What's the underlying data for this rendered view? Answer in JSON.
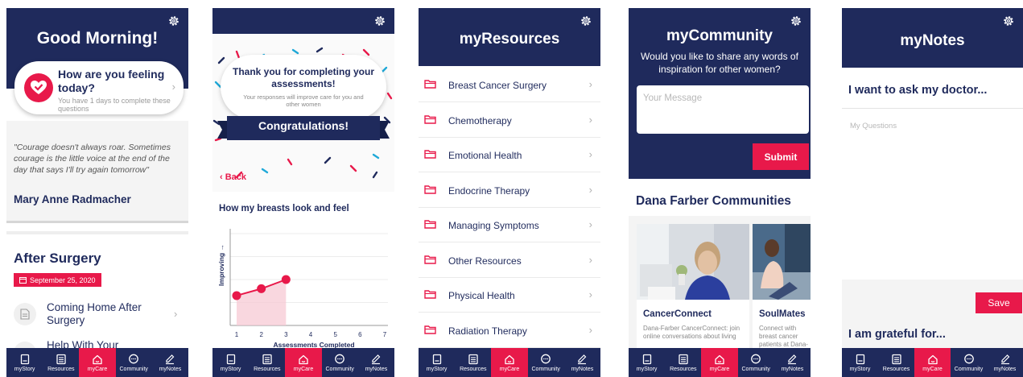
{
  "tabs": [
    {
      "label": "myStory",
      "icon": "book-icon"
    },
    {
      "label": "Resources",
      "icon": "list-icon"
    },
    {
      "label": "myCare",
      "icon": "home-icon"
    },
    {
      "label": "Community",
      "icon": "chat-icon"
    },
    {
      "label": "myNotes",
      "icon": "pencil-icon"
    }
  ],
  "active_tab": "myCare",
  "colors": {
    "navy": "#1f2a5c",
    "accent": "#e8194a"
  },
  "screen1": {
    "greeting": "Good Morning!",
    "feeling_question": "How are you feeling today?",
    "feeling_sub": "You have 1 days to complete these questions",
    "quote": "\"Courage doesn't always roar. Sometimes courage is the little voice at the end of the day that says I'll try again tomorrow\"",
    "author": "Mary Anne Radmacher",
    "section_title": "After Surgery",
    "date": "September 25, 2020",
    "lessons": [
      "Coming Home After Surgery",
      "Help With Your"
    ]
  },
  "screen2": {
    "thanks_title": "Thank you for completing your assessments!",
    "thanks_sub": "Your responses will improve care for you and other women",
    "banner": "Congratulations!",
    "back": "Back",
    "chart_title": "How my breasts look and feel",
    "chart_data": {
      "type": "line",
      "title": "How my breasts look and feel",
      "xlabel": "Assessments Completed",
      "ylabel": "Improving",
      "x": [
        1,
        2,
        3,
        4,
        5,
        6,
        7
      ],
      "series": [
        {
          "values": [
            1.3,
            1.6,
            2.0,
            null,
            null,
            null,
            null
          ]
        }
      ],
      "xlim": [
        1,
        7
      ],
      "ylim": [
        0,
        4
      ]
    }
  },
  "screen3": {
    "title": "myResources",
    "items": [
      "Breast Cancer Surgery",
      "Chemotherapy",
      "Emotional Health",
      "Endocrine Therapy",
      "Managing Symptoms",
      "Other Resources",
      "Physical Health",
      "Radiation Therapy"
    ]
  },
  "screen4": {
    "title": "myCommunity",
    "subtitle": "Would you like to share any words of inspiration for other women?",
    "message_placeholder": "Your Message",
    "submit": "Submit",
    "section_title": "Dana Farber Communities",
    "cards": [
      {
        "name": "CancerConnect",
        "desc": "Dana-Farber CancerConnect: join online conversations about living"
      },
      {
        "name": "SoulMates",
        "desc": "Connect with breast cancer patients at Dana-Farber who have been through"
      }
    ]
  },
  "screen5": {
    "title": "myNotes",
    "ask_label": "I want to ask my doctor...",
    "questions_placeholder": "My Questions",
    "save": "Save",
    "grateful_label": "I am grateful for..."
  }
}
